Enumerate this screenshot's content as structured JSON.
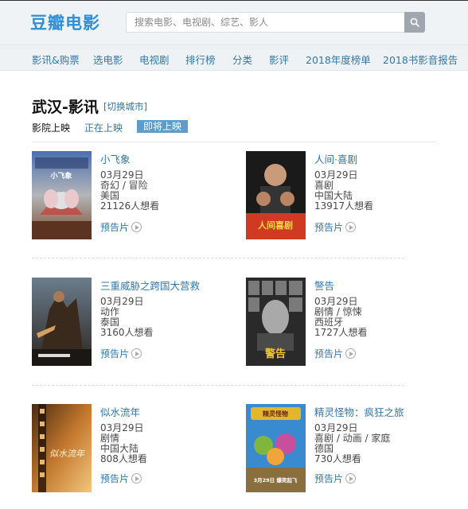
{
  "header": {
    "logo": "豆瓣电影",
    "search_placeholder": "搜索电影、电视剧、综艺、影人"
  },
  "nav": [
    "影讯&购票",
    "选电影",
    "电视剧",
    "排行榜",
    "分类",
    "影评",
    "2018年度榜单",
    "2018书影音报告"
  ],
  "page": {
    "title": "武汉-影讯",
    "switch_city": "[切换城市]"
  },
  "tabs": {
    "now_showing": "影院上映",
    "playing": "正在上映",
    "upcoming": "即将上映"
  },
  "trailer_label": "预告片",
  "movies": [
    {
      "title": "小飞象",
      "date": "03月29日",
      "genre": "奇幻 / 冒险",
      "region": "美国",
      "wish": "21126人想看"
    },
    {
      "title": "人间·喜剧",
      "date": "03月29日",
      "genre": "喜剧",
      "region": "中国大陆",
      "wish": "13917人想看"
    },
    {
      "title": "三重威胁之跨国大营救",
      "date": "03月29日",
      "genre": "动作",
      "region": "泰国",
      "wish": "3160人想看"
    },
    {
      "title": "警告",
      "date": "03月29日",
      "genre": "剧情 / 惊悚",
      "region": "西班牙",
      "wish": "1727人想看"
    },
    {
      "title": "似水流年",
      "date": "03月29日",
      "genre": "剧情",
      "region": "中国大陆",
      "wish": "808人想看"
    },
    {
      "title": "精灵怪物：疯狂之旅",
      "date": "03月29日",
      "genre": "喜剧 / 动画 / 家庭",
      "region": "德国",
      "wish": "730人想看"
    }
  ],
  "posters": {
    "m0": "小飞象",
    "m1": "人间喜剧",
    "m3": "警告",
    "m4": "似水流年",
    "m5_top": "精灵怪物",
    "m5_bottom": "3月29日 爆笑起飞",
    "m5_colors": {
      "sky": "#3a8ad0",
      "ground": "#8a6f3e",
      "banner": "#e3b62c"
    }
  },
  "colors": {
    "accent": "#3377aa",
    "logo": "#2f8fd6",
    "active_tab": "#5d9ccc",
    "header_bg": "#f0f3f5"
  }
}
